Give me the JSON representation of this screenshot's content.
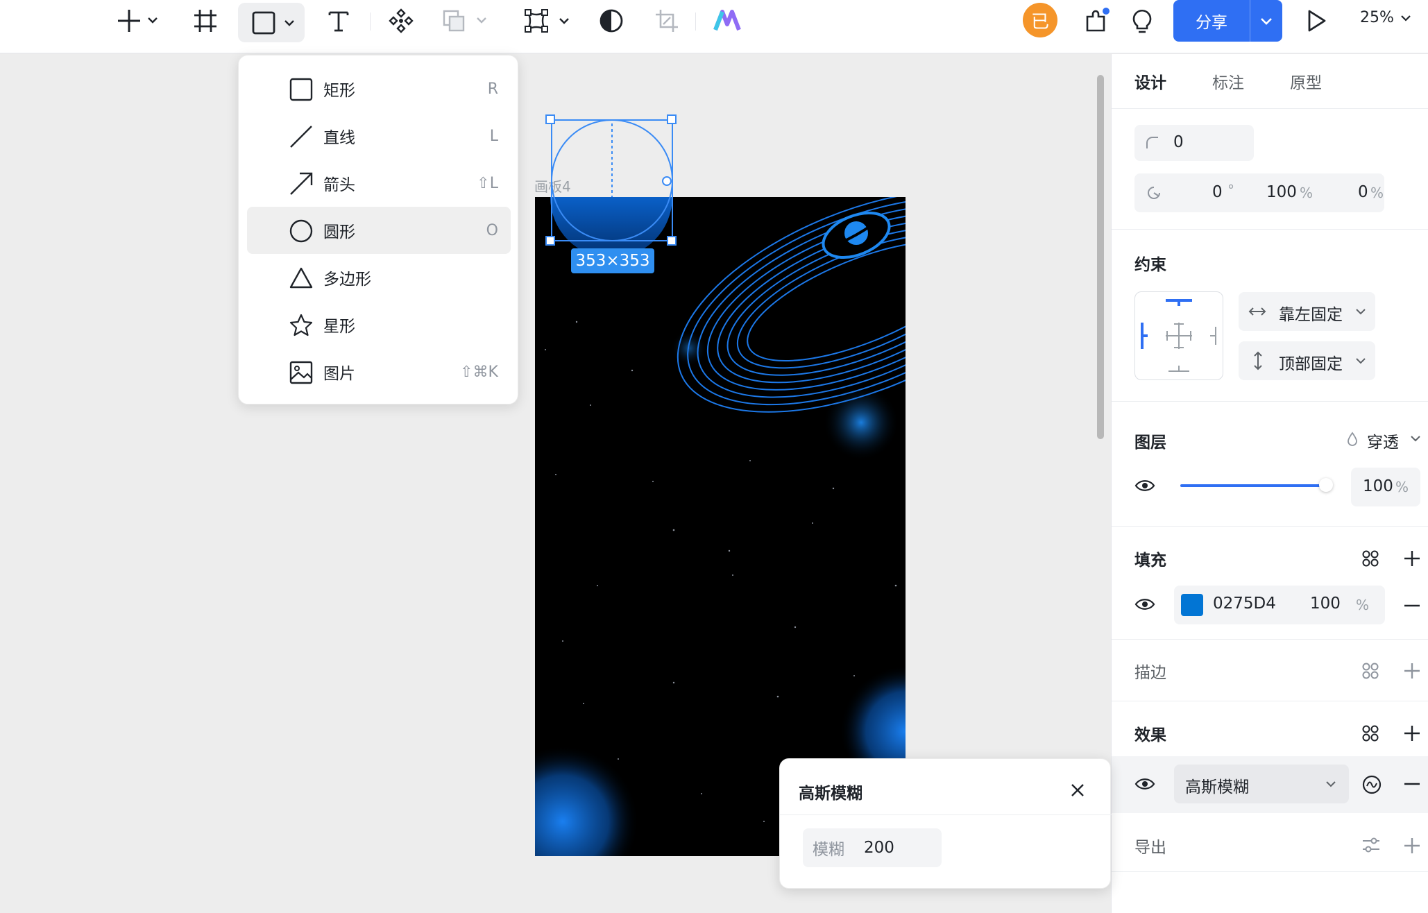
{
  "toolbar": {
    "avatar_text": "已",
    "share_label": "分享",
    "zoom_label": "25%"
  },
  "colors": {
    "accent": "#2f6ff3",
    "selection": "#3a8bf5",
    "fill_swatch": "#0275D4",
    "avatar": "#f5952a"
  },
  "shape_menu": {
    "items": [
      {
        "label": "矩形",
        "shortcut": "R",
        "icon": "rectangle-icon"
      },
      {
        "label": "直线",
        "shortcut": "L",
        "icon": "line-icon"
      },
      {
        "label": "箭头",
        "shortcut": "⇧L",
        "icon": "arrow-icon"
      },
      {
        "label": "圆形",
        "shortcut": "O",
        "icon": "ellipse-icon",
        "selected": true
      },
      {
        "label": "多边形",
        "shortcut": "",
        "icon": "polygon-icon"
      },
      {
        "label": "星形",
        "shortcut": "",
        "icon": "star-icon"
      },
      {
        "label": "图片",
        "shortcut": "⇧⌘K",
        "icon": "image-icon"
      }
    ]
  },
  "canvas": {
    "frame_label": "画板4",
    "selection_size": "353×353"
  },
  "panel": {
    "tabs": [
      "设计",
      "标注",
      "原型"
    ],
    "corner_radius": "0",
    "rotation": "0",
    "rotation_unit": "°",
    "arc_ratio": "100",
    "arc_ratio_unit": "%",
    "inner_ratio": "0",
    "inner_ratio_unit": "%",
    "constraints_title": "约束",
    "constraint_h": "靠左固定",
    "constraint_v": "顶部固定",
    "layer_title": "图层",
    "blend_mode": "穿透",
    "opacity": "100",
    "opacity_unit": "%",
    "opacity_fraction": 1.0,
    "fill_title": "填充",
    "fill_hex": "0275D4",
    "fill_opacity": "100",
    "fill_opacity_unit": "%",
    "stroke_title": "描边",
    "effects_title": "效果",
    "effect_name": "高斯模糊",
    "export_title": "导出"
  },
  "blur_popup": {
    "title": "高斯模糊",
    "field_label": "模糊",
    "field_value": "200"
  }
}
